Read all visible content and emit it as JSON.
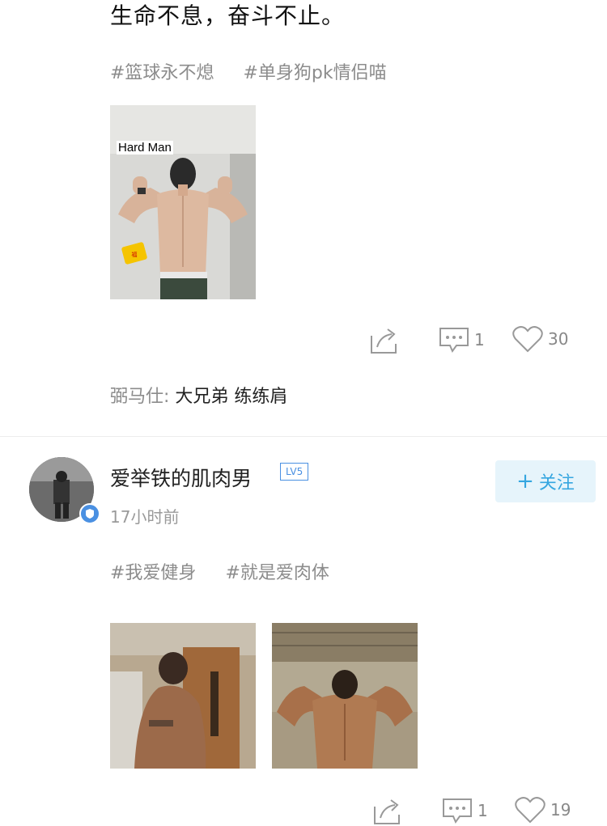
{
  "post1": {
    "text": "生命不息，奋斗不止。",
    "tags": [
      "#篮球永不熄",
      "#单身狗pk情侣喵"
    ],
    "image_caption": "Hard Man",
    "actions": {
      "comments": "1",
      "likes": "30"
    },
    "reply": {
      "name": "弼马仕:",
      "text": "大兄弟 练练肩"
    }
  },
  "post2": {
    "username": "爱举铁的肌肉男",
    "level": "LV5",
    "time": "17小时前",
    "follow_label": "关注",
    "tags": [
      "#我爱健身",
      "#就是爱肉体"
    ],
    "actions": {
      "comments": "1",
      "likes": "19"
    }
  },
  "colors": {
    "accent": "#35a6e0",
    "tag": "#8c8c8c",
    "follow_bg": "#e6f4fb"
  },
  "icons": [
    "share-icon",
    "comment-icon",
    "heart-icon",
    "plus-icon",
    "verified-badge-icon"
  ]
}
